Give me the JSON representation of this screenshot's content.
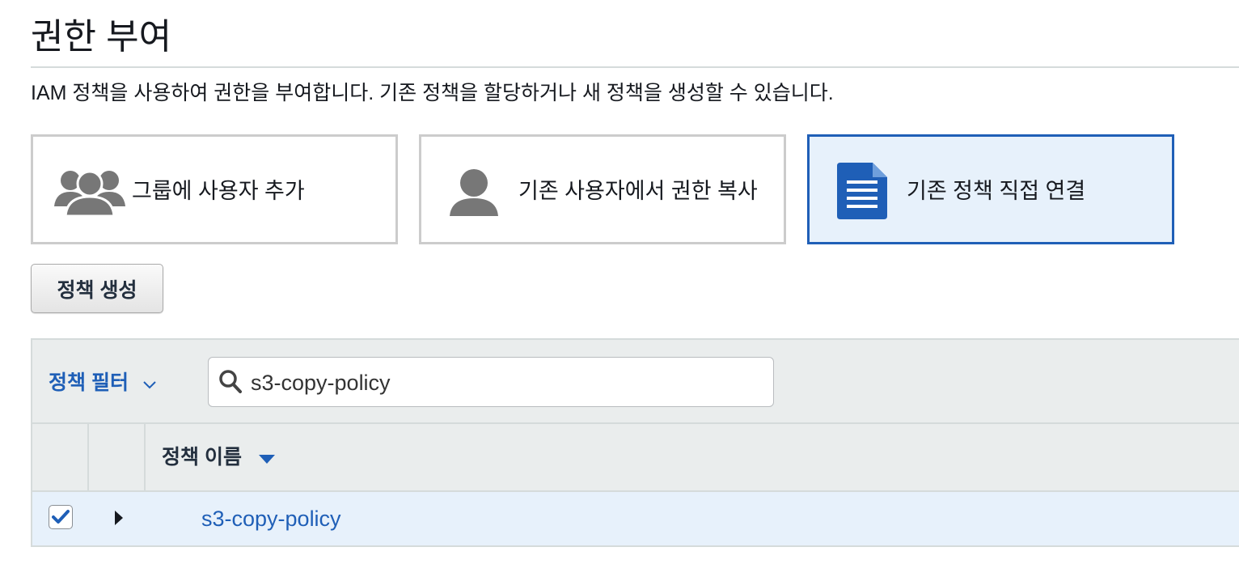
{
  "header": {
    "title": "권한 부여",
    "description": "IAM 정책을 사용하여 권한을 부여합니다. 기존 정책을 할당하거나 새 정책을 생성할 수 있습니다."
  },
  "options": [
    {
      "label": "그룹에 사용자 추가",
      "icon": "group-icon",
      "selected": false
    },
    {
      "label": "기존 사용자에서 권한 복사",
      "icon": "user-icon",
      "selected": false
    },
    {
      "label": "기존 정책 직접 연결",
      "icon": "document-icon",
      "selected": true
    }
  ],
  "toolbar": {
    "create_policy_label": "정책 생성"
  },
  "filter": {
    "label": "정책 필터",
    "search_value": "s3-copy-policy"
  },
  "table": {
    "columns": {
      "name_label": "정책 이름"
    },
    "rows": [
      {
        "name": "s3-copy-policy",
        "checked": true
      }
    ]
  },
  "colors": {
    "accent": "#1f5fb7",
    "selected_bg": "#e7f1fb",
    "header_bg": "#eaeded",
    "icon_gray": "#777777"
  }
}
